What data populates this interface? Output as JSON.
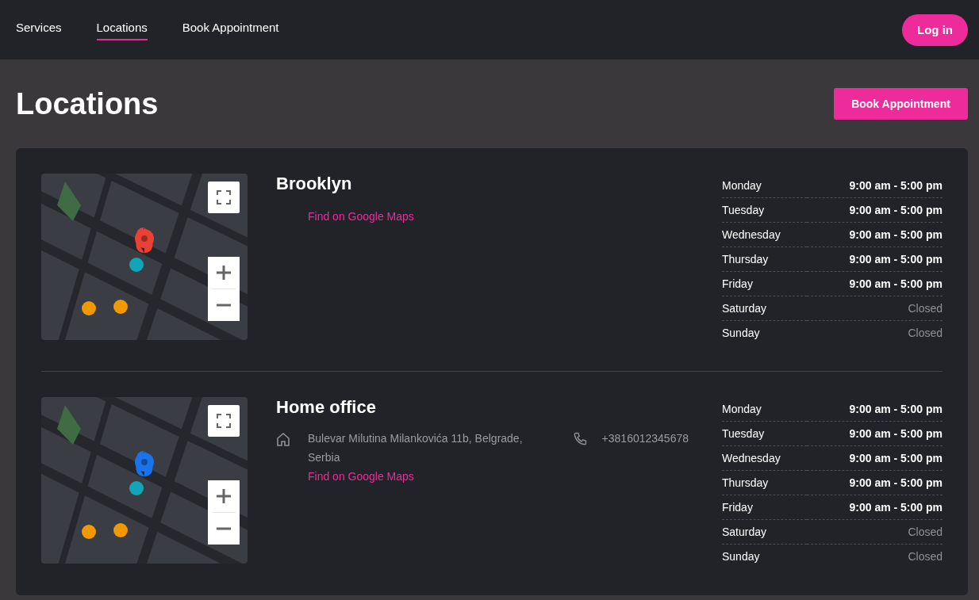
{
  "nav": {
    "links": [
      {
        "label": "Services",
        "selected": false
      },
      {
        "label": "Locations",
        "selected": true
      },
      {
        "label": "Book Appointment",
        "selected": false
      }
    ],
    "login": "Log in"
  },
  "page": {
    "title": "Locations",
    "action": "Book Appointment"
  },
  "locations": [
    {
      "name": "Brooklyn",
      "maps_link": "Find on Google Maps",
      "hours": [
        {
          "day": "Monday",
          "hours": "9:00 am - 5:00 pm",
          "closed": false
        },
        {
          "day": "Tuesday",
          "hours": "9:00 am - 5:00 pm",
          "closed": false
        },
        {
          "day": "Wednesday",
          "hours": "9:00 am - 5:00 pm",
          "closed": false
        },
        {
          "day": "Thursday",
          "hours": "9:00 am - 5:00 pm",
          "closed": false
        },
        {
          "day": "Friday",
          "hours": "9:00 am - 5:00 pm",
          "closed": false
        },
        {
          "day": "Saturday",
          "hours": "Closed",
          "closed": true
        },
        {
          "day": "Sunday",
          "hours": "Closed",
          "closed": true
        }
      ]
    },
    {
      "name": "Home office",
      "address": "Bulevar Milutina Milankovića 11b, Belgrade, Serbia",
      "phone": "+3816012345678",
      "maps_link": "Find on Google Maps",
      "hours": [
        {
          "day": "Monday",
          "hours": "9:00 am - 5:00 pm",
          "closed": false
        },
        {
          "day": "Tuesday",
          "hours": "9:00 am - 5:00 pm",
          "closed": false
        },
        {
          "day": "Wednesday",
          "hours": "9:00 am - 5:00 pm",
          "closed": false
        },
        {
          "day": "Thursday",
          "hours": "9:00 am - 5:00 pm",
          "closed": false
        },
        {
          "day": "Friday",
          "hours": "9:00 am - 5:00 pm",
          "closed": false
        },
        {
          "day": "Saturday",
          "hours": "Closed",
          "closed": true
        },
        {
          "day": "Sunday",
          "hours": "Closed",
          "closed": true
        }
      ]
    }
  ]
}
